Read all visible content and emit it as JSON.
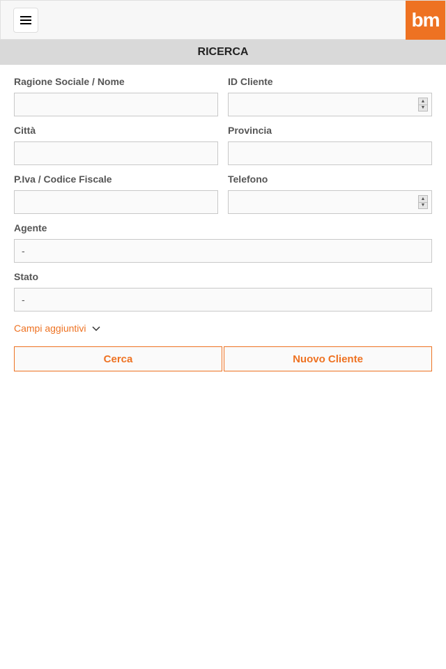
{
  "header": {
    "logo_text": "bm"
  },
  "title": "RICERCA",
  "fields": {
    "ragione_sociale": {
      "label": "Ragione Sociale / Nome",
      "value": ""
    },
    "id_cliente": {
      "label": "ID Cliente",
      "value": ""
    },
    "citta": {
      "label": "Città",
      "value": ""
    },
    "provincia": {
      "label": "Provincia",
      "value": ""
    },
    "piva": {
      "label": "P.Iva / Codice Fiscale",
      "value": ""
    },
    "telefono": {
      "label": "Telefono",
      "value": ""
    },
    "agente": {
      "label": "Agente",
      "value": "-"
    },
    "stato": {
      "label": "Stato",
      "value": "-"
    }
  },
  "expand": {
    "label": "Campi aggiuntivi"
  },
  "buttons": {
    "search": "Cerca",
    "new_client": "Nuovo Cliente"
  }
}
